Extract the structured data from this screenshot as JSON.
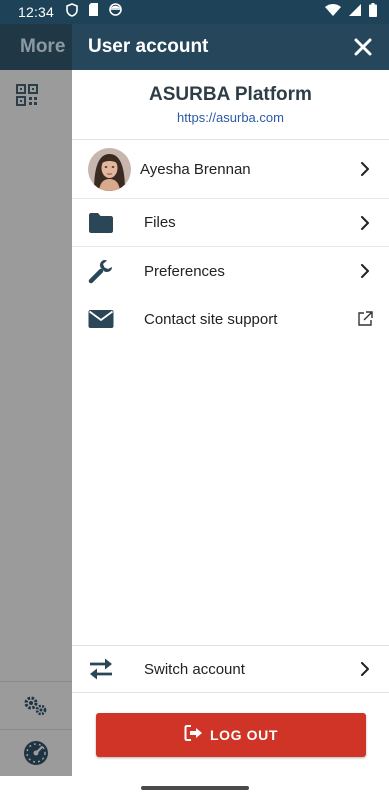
{
  "status_bar": {
    "time": "12:34",
    "icons": [
      "shield-icon",
      "sd-card-icon",
      "face-icon",
      "wifi-icon",
      "signal-icon",
      "battery-icon"
    ]
  },
  "underlying_screen": {
    "title": "More",
    "icons": [
      "qr-code-icon",
      "settings-gears-icon",
      "dashboard-icon"
    ]
  },
  "drawer": {
    "title": "User account",
    "platform": {
      "name": "ASURBA Platform",
      "url": "https://asurba.com"
    },
    "user": {
      "name": "Ayesha Brennan"
    },
    "items": [
      {
        "label": "Files",
        "icon": "folder-icon",
        "end": "chevron-right-icon"
      },
      {
        "label": "Preferences",
        "icon": "wrench-icon",
        "end": "chevron-right-icon"
      },
      {
        "label": "Contact site support",
        "icon": "envelope-icon",
        "end": "external-link-icon"
      }
    ],
    "switch_account": {
      "label": "Switch account",
      "icon": "swap-arrows-icon"
    },
    "logout": {
      "label": "LOG OUT",
      "icon": "logout-icon"
    }
  },
  "colors": {
    "header": "#25465b",
    "status_bar": "#1e4258",
    "logout": "#cf3427",
    "link": "#2a5aa8",
    "icon": "#2b4657"
  }
}
